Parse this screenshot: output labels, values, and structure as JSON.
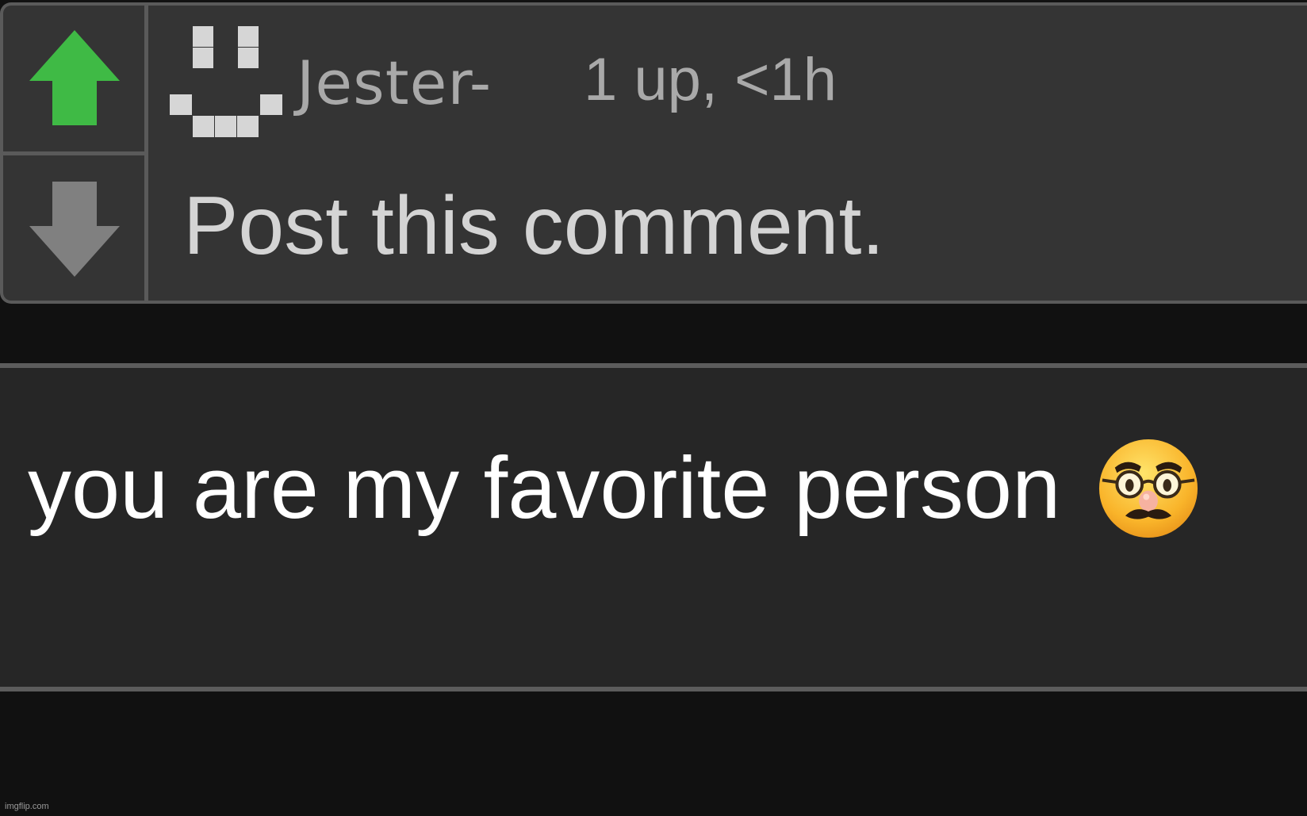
{
  "comment": {
    "username": "Jester-",
    "meta": "1 up, <1h",
    "text": "Post this comment.",
    "vote": {
      "upvote_icon": "arrow-up-icon",
      "downvote_icon": "arrow-down-icon",
      "upvote_color": "#3fba45",
      "downvote_color": "#808080"
    },
    "avatar_icon": "pixel-smiley-icon"
  },
  "reply": {
    "text": "you are my favorite person",
    "emoji_icon": "disguised-face-emoji-icon"
  },
  "watermark": "imgflip.com",
  "colors": {
    "background": "#111111",
    "card": "#343434",
    "reply_box": "#262626",
    "border": "#5a5a5a",
    "muted_text": "#a9a9a9",
    "comment_text": "#d4d4d4"
  }
}
